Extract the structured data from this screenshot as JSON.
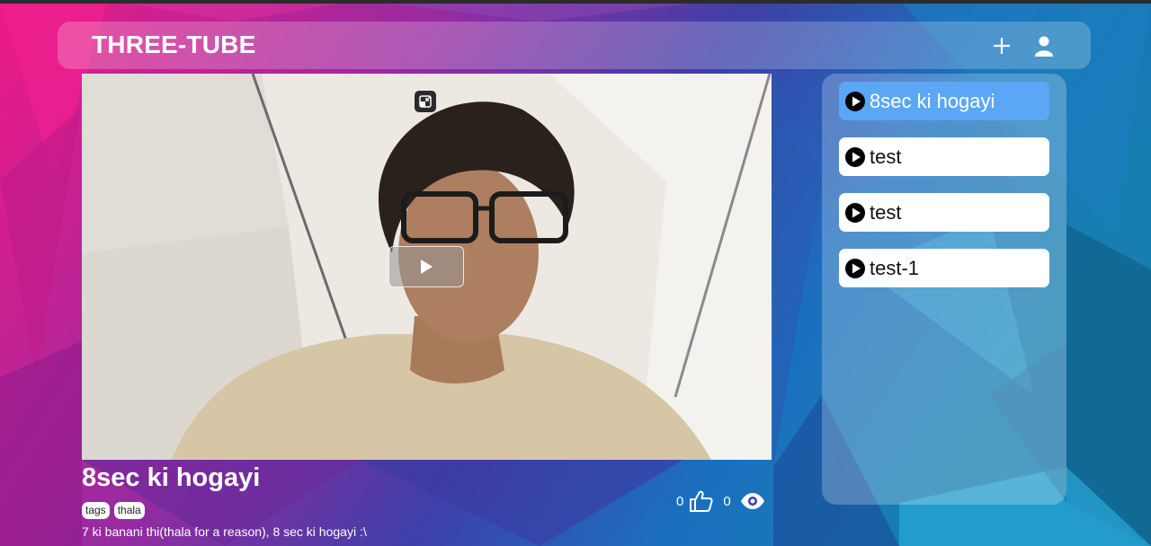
{
  "header": {
    "brand": "THREE-TUBE",
    "add_icon": "plus-icon",
    "account_icon": "user-icon"
  },
  "player": {
    "pip_icon": "picture-in-picture-icon",
    "play_icon": "play-icon"
  },
  "video": {
    "title": "8sec ki hogayi",
    "tags": [
      "tags",
      "thala"
    ],
    "description": "7 ki banani thi(thala for a reason), 8 sec ki hogayi :\\",
    "likes": "0",
    "views": "0",
    "like_icon": "thumbs-up-icon",
    "views_icon": "eye-icon"
  },
  "playlist": {
    "items": [
      {
        "label": "8sec ki hogayi",
        "active": true
      },
      {
        "label": "test",
        "active": false
      },
      {
        "label": "test",
        "active": false
      },
      {
        "label": "test-1",
        "active": false
      }
    ],
    "item_icon": "play-circle-icon",
    "active_color": "#5ba7f5"
  },
  "colors": {
    "bg_pink": "#e8127f",
    "bg_purple": "#5a2a9a",
    "bg_blue": "#1a78c2",
    "bg_cyan": "#2bb0dd"
  }
}
